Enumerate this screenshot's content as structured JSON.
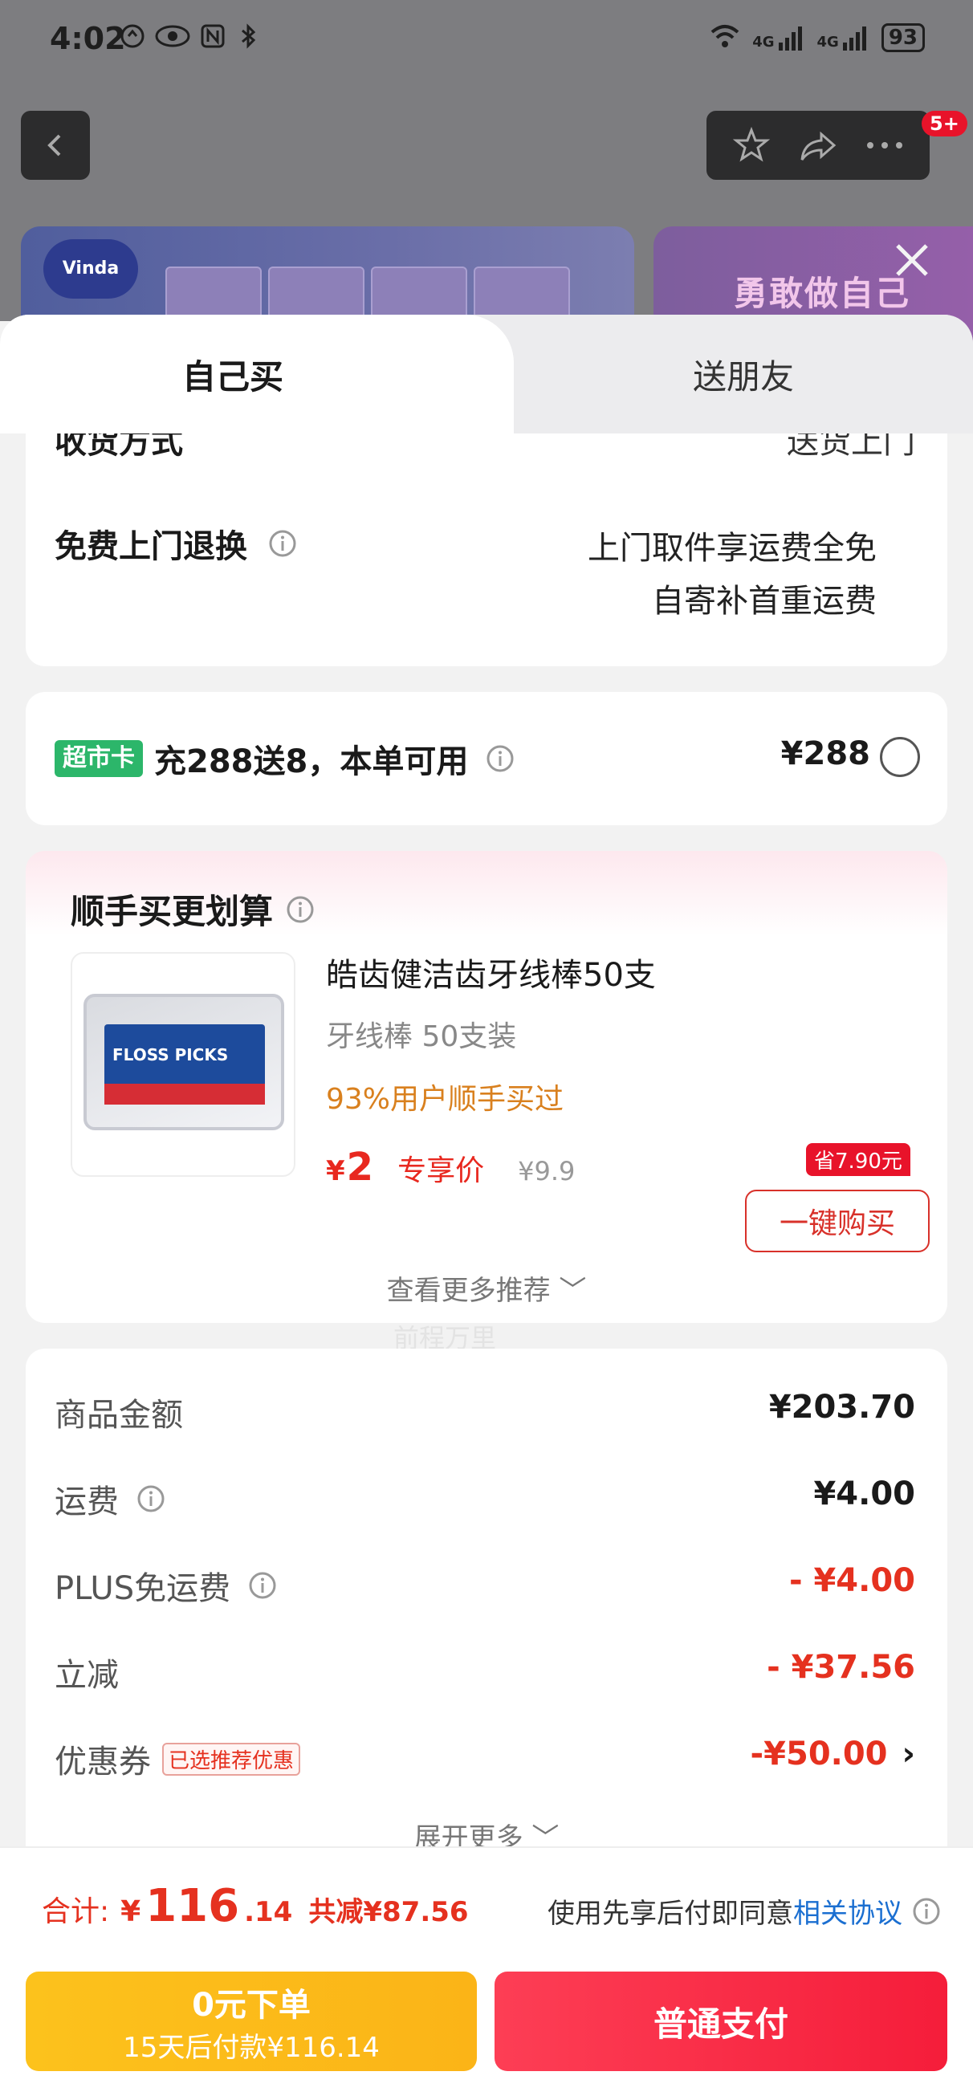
{
  "status": {
    "time": "4:02",
    "network1": "4G",
    "network2": "4G",
    "battery": "93"
  },
  "nav": {
    "badge": "5+"
  },
  "banner": {
    "logo_text": "Vinda",
    "right_text": "勇敢做自己"
  },
  "tabs": [
    {
      "label": "自己买"
    },
    {
      "label": "送朋友"
    }
  ],
  "shipping": {
    "cut_label": "收货方式",
    "cut_value": "送货上门",
    "return_label": "免费上门退换",
    "return_line1": "上门取件享运费全免",
    "return_line2": "自寄补首重运费"
  },
  "club": {
    "badge": "超市卡",
    "text": "充288送8，本单可用",
    "price": "¥288"
  },
  "upsell": {
    "title": "顺手买更划算",
    "product_name": "皓齿健洁齿牙线棒50支",
    "spec": "牙线棒 50支装",
    "social": "93%用户顺手买过",
    "currency": "¥",
    "price": "2",
    "price_tag": "专享价",
    "original_price": "¥9.9",
    "save_badge": "省7.90元",
    "buy_button": "一键购买",
    "see_more": "查看更多推荐 ﹀",
    "image_text": "FLOSS PICKS",
    "watermark": "前程万里"
  },
  "summary": {
    "rows": [
      {
        "label": "商品金额",
        "value": "¥203.70"
      },
      {
        "label": "运费",
        "value": "¥4.00"
      },
      {
        "label": "PLUS免运费",
        "value": "- ¥4.00"
      },
      {
        "label": "立减",
        "value": "- ¥37.56"
      },
      {
        "label": "优惠券",
        "tag": "已选推荐优惠",
        "value": "-¥50.00"
      }
    ],
    "expand": "展开更多 ﹀"
  },
  "bottom": {
    "total_label": "合计:",
    "currency": "¥",
    "total_int": "116",
    "total_dec": ".14",
    "total_save": "共减¥87.56",
    "agree_text": "使用先享后付即同意",
    "agree_link": "相关协议",
    "bnpl_line1": "0元下单",
    "bnpl_line2": "15天后付款¥116.14",
    "pay_button": "普通支付"
  },
  "colors": {
    "accent_red": "#e5311f",
    "club_green": "#2cb66a",
    "link_blue": "#1b6fd1",
    "bnpl_yellow": "#fcc21c",
    "pay_red": "#f51d3a"
  }
}
